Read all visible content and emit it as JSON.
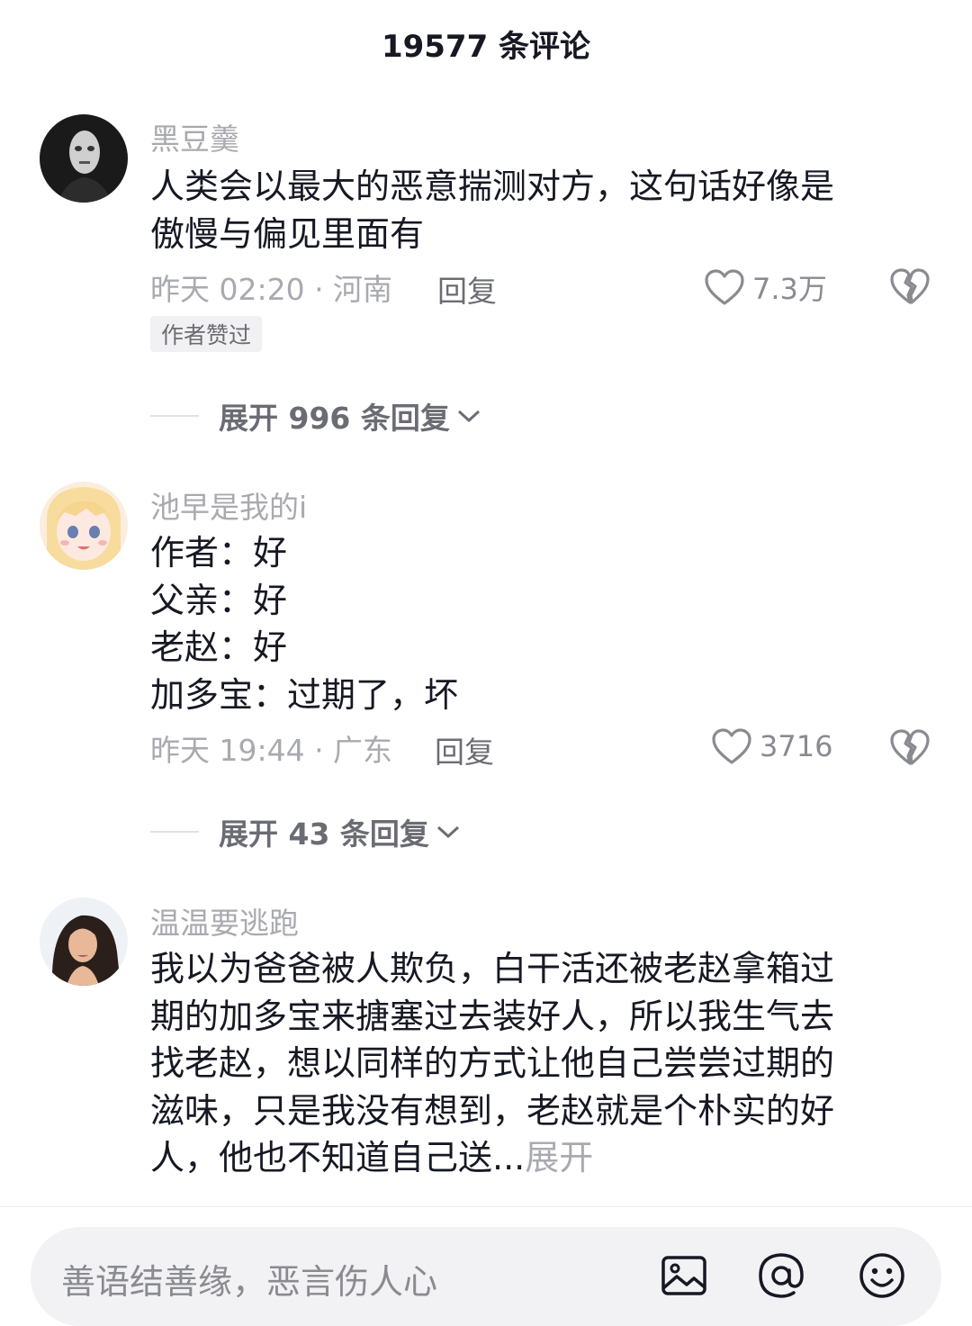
{
  "header": {
    "title": "19577 条评论"
  },
  "comments": [
    {
      "username": "黑豆羹",
      "lines": [
        "人类会以最大的恶意揣测对方，这句话好像是",
        "傲慢与偏见里面有"
      ],
      "time_location": "昨天 02:20 · 河南",
      "reply_label": "回复",
      "like_count": "7.3万",
      "badge": "作者赞过",
      "expand_replies": "展开 996 条回复"
    },
    {
      "username": "池早是我的i",
      "lines": [
        "作者：好",
        "父亲：好",
        "老赵：好",
        "加多宝：过期了，坏"
      ],
      "time_location": "昨天 19:44 · 广东",
      "reply_label": "回复",
      "like_count": "3716",
      "expand_replies": "展开 43 条回复"
    },
    {
      "username": "温温要逃跑",
      "lines": [
        "我以为爸爸被人欺负，白干活还被老赵拿箱过",
        "期的加多宝来搪塞过去装好人，所以我生气去",
        "找老赵，想以同样的方式让他自己尝尝过期的",
        "滋味，只是我没有想到，老赵就是个朴实的好",
        "人，他也不知道自己送..."
      ],
      "expand_label": "展开"
    }
  ],
  "input_bar": {
    "placeholder": "善语结善缘，恶言伤人心",
    "icons": [
      "image-icon",
      "at-icon",
      "emoji-icon"
    ]
  },
  "colors": {
    "text_primary": "#161823",
    "text_secondary": "#a9aab0",
    "action_gray": "#6b6c73",
    "input_bg": "#f2f2f4"
  }
}
